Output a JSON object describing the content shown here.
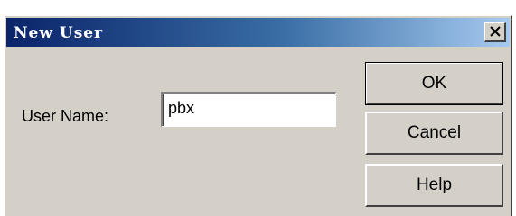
{
  "dialog": {
    "title": "New User",
    "close_symbol": "×",
    "close_icon": "close-icon"
  },
  "form": {
    "user_name_label": "User Name:",
    "user_name_value": "pbx"
  },
  "buttons": {
    "ok_label": "OK",
    "cancel_label": "Cancel",
    "help_label": "Help"
  },
  "colors": {
    "titlebar_start": "#0a246a",
    "titlebar_end": "#a6caf0",
    "face": "#d4d0c8"
  }
}
